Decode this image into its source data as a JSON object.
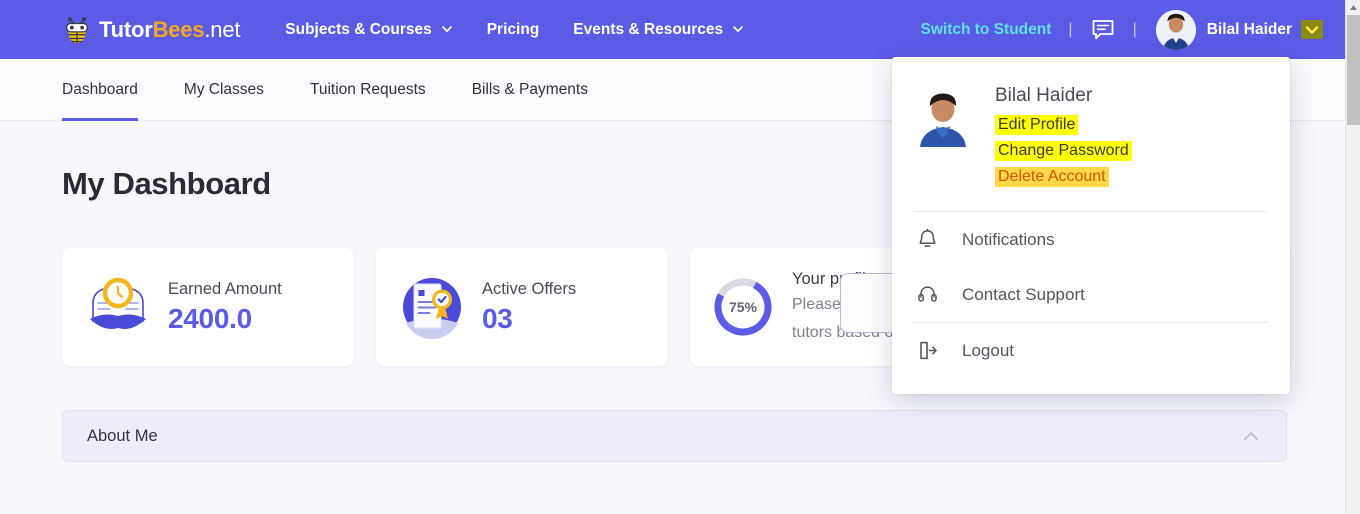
{
  "header": {
    "brand": {
      "part1": "Tutor",
      "part2": "Bees",
      "part3": ".net",
      "icon": "bee-logo-icon"
    },
    "nav": [
      {
        "label": "Subjects & Courses",
        "has_caret": true
      },
      {
        "label": "Pricing",
        "has_caret": false
      },
      {
        "label": "Events & Resources",
        "has_caret": true
      }
    ],
    "switch_role": "Switch to Student",
    "divider": "|",
    "chat_icon": "chat-bubble-icon",
    "user_name": "Bilal Haider",
    "caret_icon": "chevron-down-icon",
    "bg_color": "#5b5be6",
    "accent_cyan": "#5ce1e6"
  },
  "subnav": {
    "tabs": [
      {
        "label": "Dashboard",
        "active": true
      },
      {
        "label": "My Classes",
        "active": false
      },
      {
        "label": "Tuition Requests",
        "active": false
      },
      {
        "label": "Bills & Payments",
        "active": false
      }
    ],
    "active_underline_color": "#5b5be6"
  },
  "main": {
    "page_title": "My Dashboard",
    "cards": [
      {
        "icon": "book-clock-icon",
        "label": "Earned Amount",
        "value": "2400.0"
      },
      {
        "icon": "document-award-icon",
        "label": "Active Offers",
        "value": "03"
      }
    ],
    "profile_card": {
      "percent_label": "75%",
      "percent_value": 75,
      "line1": "Your profile at ",
      "line2": "Please comple",
      "line3": "tutors based o",
      "ring_color": "#5b5be6",
      "ring_track": "#d9d9e3"
    },
    "about_me": {
      "title": "About Me",
      "collapse_icon": "chevron-up-icon"
    },
    "value_color": "#5b5be6"
  },
  "dropdown": {
    "avatar": "user-avatar",
    "name": "Bilal Haider",
    "links": [
      {
        "label": "Edit Profile",
        "highlight": "yellow"
      },
      {
        "label": "Change Password",
        "highlight": "yellow"
      },
      {
        "label": "Delete Account",
        "highlight": "orange"
      }
    ],
    "items": [
      {
        "icon": "bell-icon",
        "label": "Notifications"
      },
      {
        "icon": "headset-icon",
        "label": "Contact Support"
      },
      {
        "icon": "logout-icon",
        "label": "Logout"
      }
    ],
    "highlight_yellow": "#ffff00",
    "highlight_orange": "#ffd94a"
  },
  "scrollbar": {
    "up_arrow": "scroll-up-arrow",
    "position": "top"
  }
}
